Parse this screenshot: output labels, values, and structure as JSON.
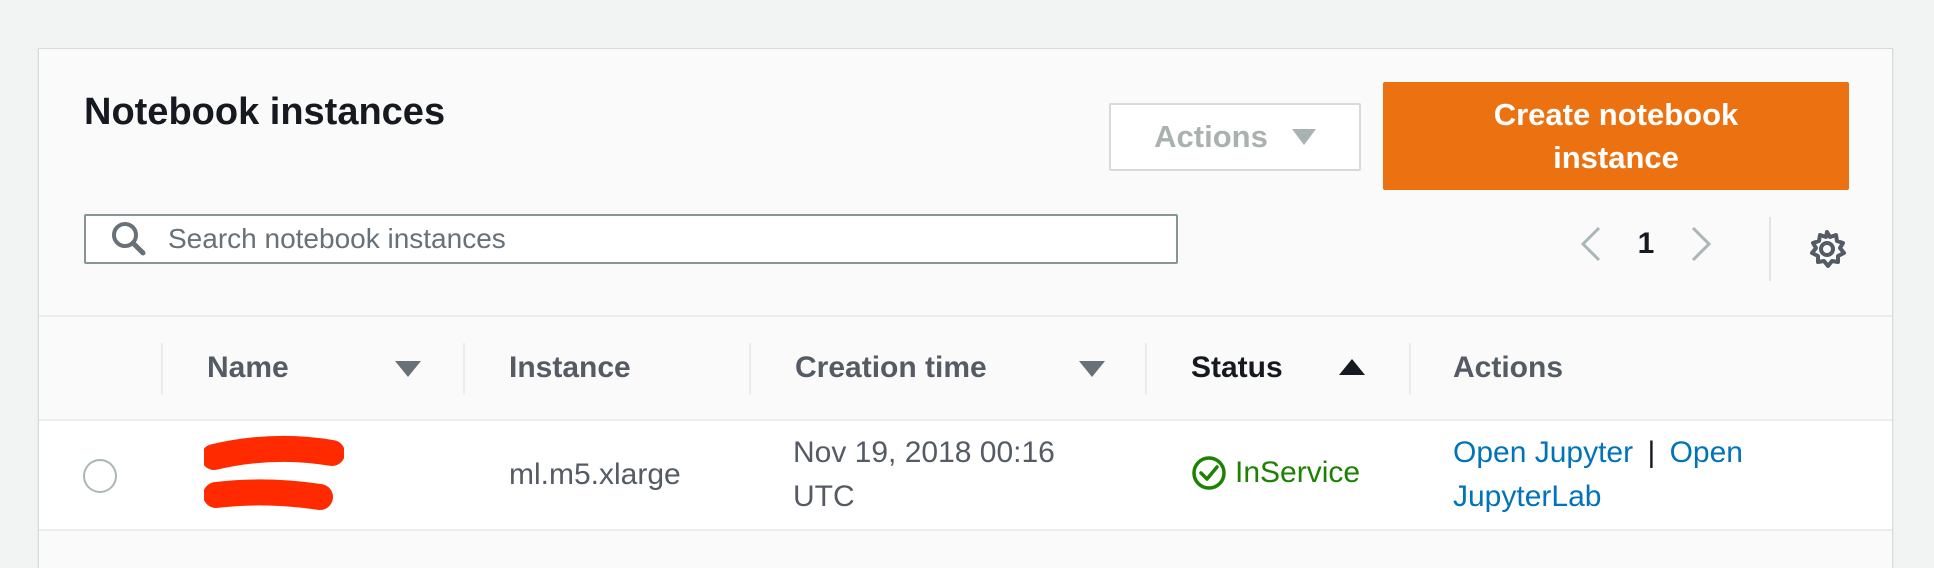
{
  "header": {
    "title": "Notebook instances",
    "actions_label": "Actions",
    "create_label": "Create notebook instance"
  },
  "search": {
    "placeholder": "Search notebook instances",
    "value": ""
  },
  "pagination": {
    "current_page": "1"
  },
  "table": {
    "columns": {
      "name": "Name",
      "instance": "Instance",
      "creation_time": "Creation time",
      "status": "Status",
      "actions": "Actions"
    },
    "rows": [
      {
        "name": "",
        "instance": "ml.m5.xlarge",
        "creation_time": "Nov 19, 2018 00:16 UTC",
        "status": "InService",
        "action_open_jupyter": "Open Jupyter",
        "action_separator": "|",
        "action_open_jupyterlab": "Open JupyterLab"
      }
    ]
  },
  "colors": {
    "primary_button": "#ec7211",
    "status_ok": "#1d8102",
    "link": "#0073bb",
    "redaction": "#ff2a00"
  },
  "icons": {
    "search": "search-icon",
    "prev": "chevron-left-icon",
    "next": "chevron-right-icon",
    "settings": "gear-icon",
    "status": "check-circle-icon"
  }
}
